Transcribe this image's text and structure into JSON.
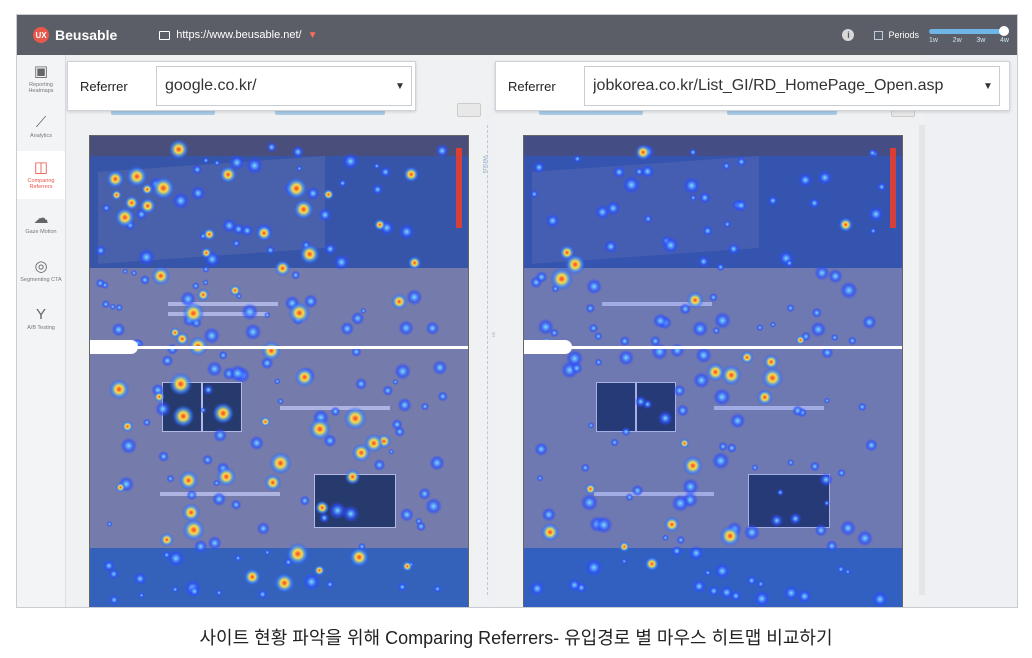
{
  "app": {
    "logo_mark": "UX",
    "logo_text": "Beusable",
    "url": "https://www.beusable.net/",
    "periods_label": "Periods",
    "period_ticks": [
      "1w",
      "2w",
      "3w",
      "4w"
    ],
    "info_icon": "i"
  },
  "sidebar": {
    "items": [
      {
        "label": "Reporting Heatmaps",
        "icon": "heatmap-icon",
        "active": false
      },
      {
        "label": "Analytics",
        "icon": "analytics-icon",
        "active": false
      },
      {
        "label": "Comparing Referrers",
        "icon": "compare-icon",
        "active": true
      },
      {
        "label": "Gaze Motion",
        "icon": "gaze-icon",
        "active": false
      },
      {
        "label": "Segmenting CTA",
        "icon": "segment-icon",
        "active": false
      },
      {
        "label": "A/B Testing",
        "icon": "ab-test-icon",
        "active": false
      }
    ]
  },
  "left_panel": {
    "referrer_label": "Referrer",
    "referrer_value": "google.co.kr/"
  },
  "right_panel": {
    "referrer_label": "Referrer",
    "referrer_value": "jobkorea.co.kr/List_GI/RD_HomePage_Open.asp"
  },
  "divider": {
    "versus": "Versus",
    "sync": "Sync"
  },
  "caption": "사이트 현황 파악을 위해 Comparing Referrers- 유입경로 별 마우스 히트맵 비교하기",
  "colors": {
    "appbar": "#5b5e66",
    "accent": "#e9574a",
    "heat_low": "#2b4dff",
    "heat_mid": "#f4e04d",
    "heat_high": "#ff3b1f"
  }
}
